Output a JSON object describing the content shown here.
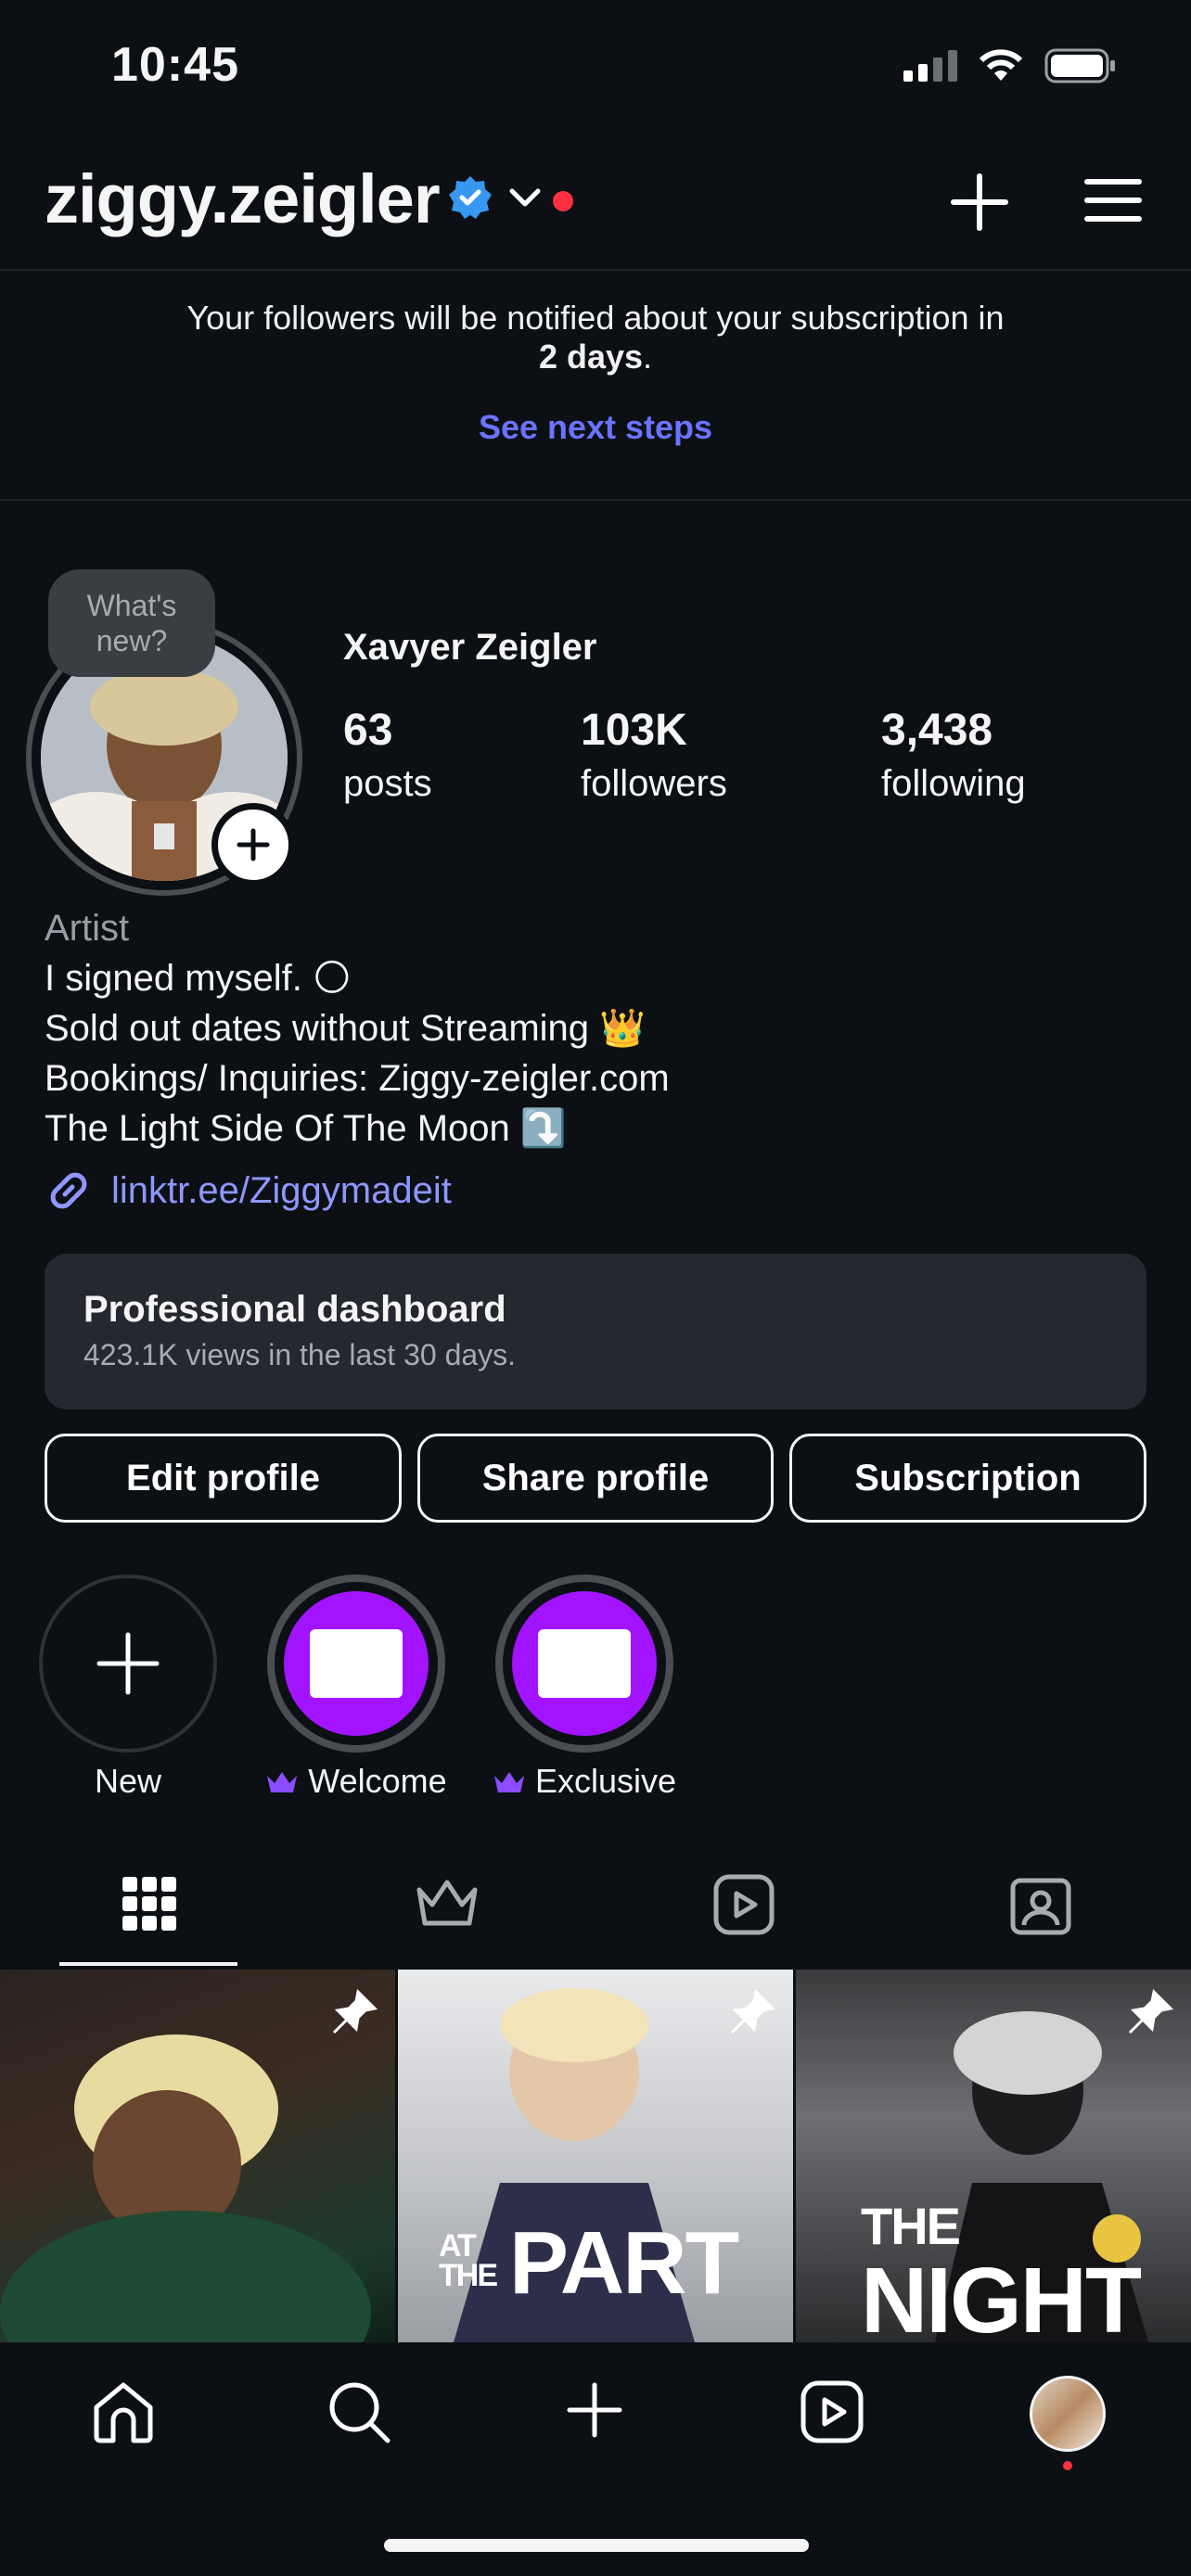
{
  "status": {
    "time": "10:45"
  },
  "header": {
    "username": "ziggy.zeigler"
  },
  "notice": {
    "line1": "Your followers will be notified about your subscription in",
    "line2_bold": "2 days",
    "line2_end": ".",
    "link": "See next steps"
  },
  "profile": {
    "whats_new_1": "What's",
    "whats_new_2": "new?",
    "display_name": "Xavyer Zeigler",
    "stats": [
      {
        "value": "63",
        "label": "posts"
      },
      {
        "value": "103K",
        "label": "followers"
      },
      {
        "value": "3,438",
        "label": "following"
      }
    ],
    "category": "Artist",
    "bio": [
      "I signed myself. 🌕",
      "Sold out dates without Streaming 👑",
      "Bookings/ Inquiries: Ziggy-zeigler.com",
      "The Light Side Of The Moon ⤵️"
    ],
    "link": "linktr.ee/Ziggymadeit"
  },
  "dashboard": {
    "title": "Professional dashboard",
    "subtitle": "423.1K views in the last 30 days."
  },
  "buttons": {
    "edit": "Edit profile",
    "share": "Share profile",
    "subscription": "Subscription"
  },
  "highlights": [
    {
      "label": "New"
    },
    {
      "label": "Welcome"
    },
    {
      "label": "Exclusive"
    }
  ],
  "posts": [
    {
      "overlay": ""
    },
    {
      "overlay_small_1": "AT",
      "overlay_small_2": "THE",
      "overlay_big": "PART"
    },
    {
      "overlay_line1": "THE",
      "overlay_line2": "NIGHT"
    }
  ],
  "colors": {
    "background": "#0c1014",
    "accent_link": "#6b73ff",
    "highlight_purple": "#a213ff",
    "notification_red": "#ff3040",
    "verified_blue": "#3897f0"
  }
}
